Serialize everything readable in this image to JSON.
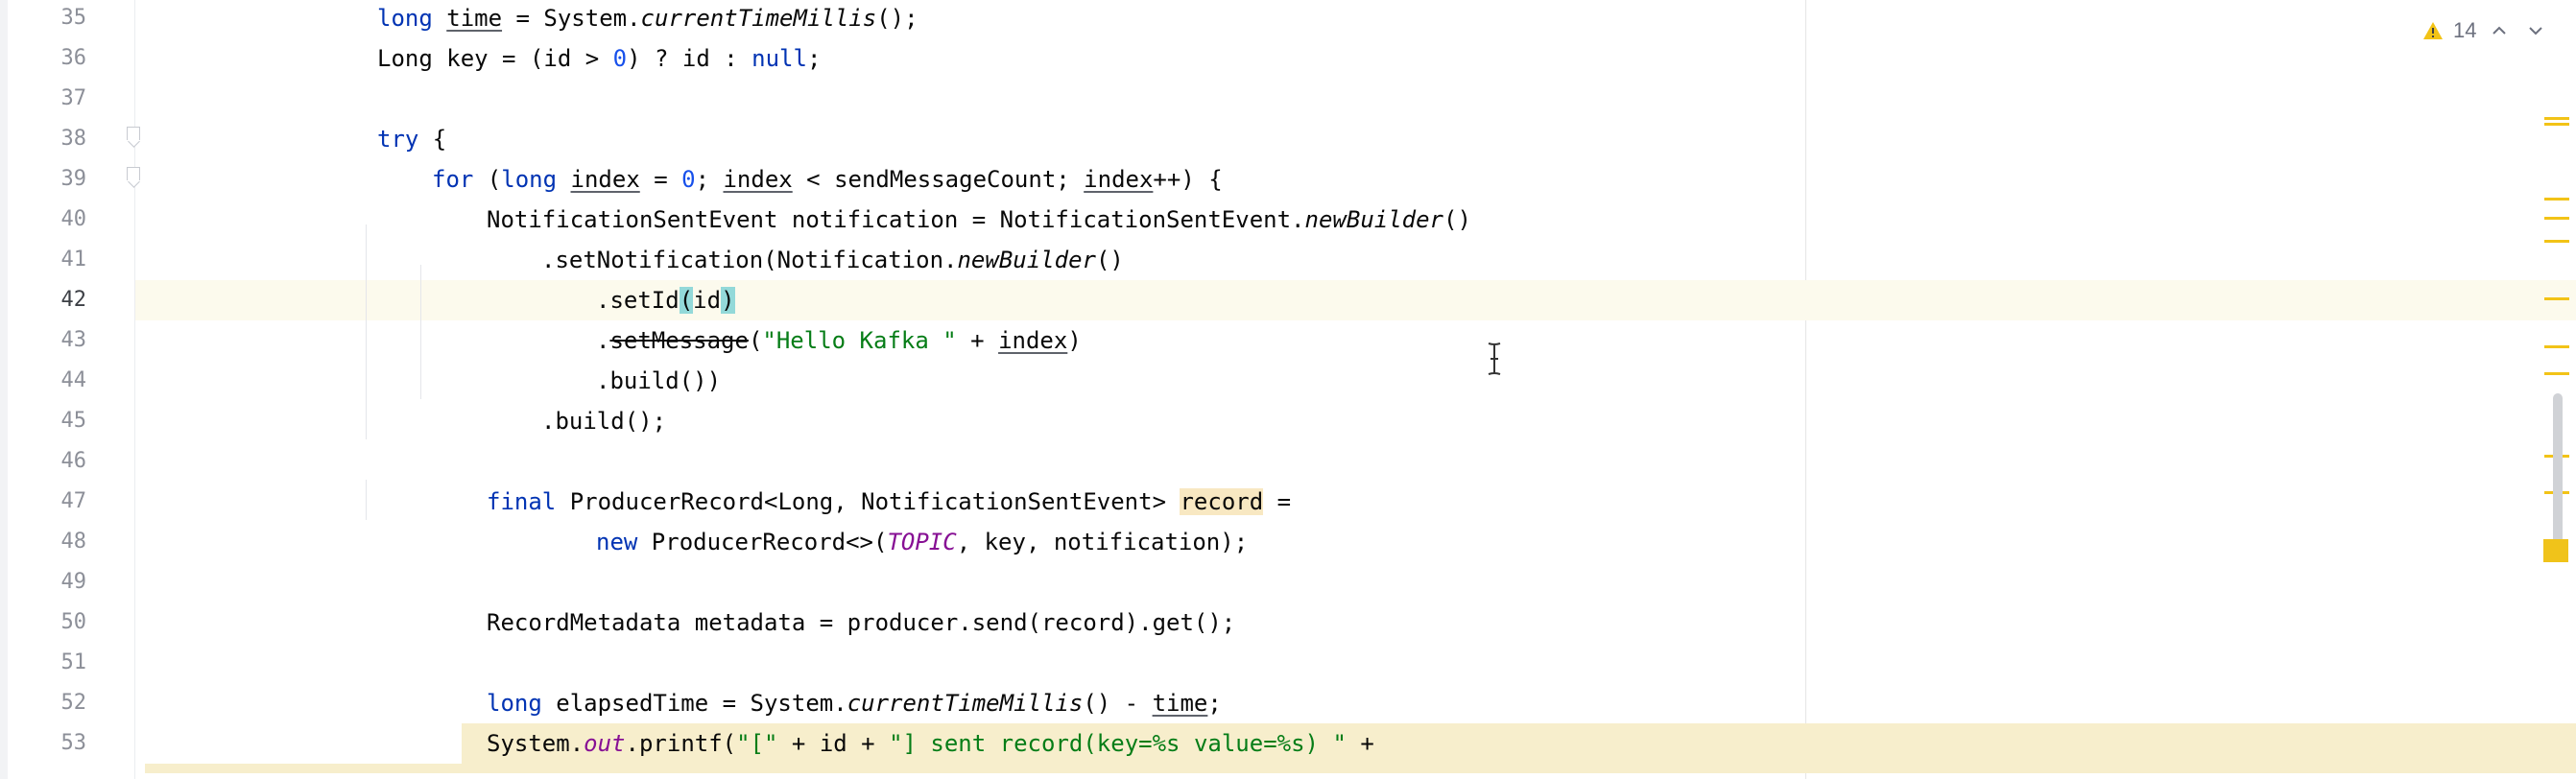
{
  "editor": {
    "lines": [
      {
        "n": "35",
        "html": "<span class=\"kw\">long</span> <span class=\"ul\">time</span> = System.<span class=\"it\">currentTimeMillis</span>();"
      },
      {
        "n": "36",
        "html": "Long key = (id &gt; <span class=\"num\">0</span>) ? id : <span class=\"kw\">null</span>;"
      },
      {
        "n": "37",
        "html": ""
      },
      {
        "n": "38",
        "html": "<span class=\"kw\">try</span> {"
      },
      {
        "n": "39",
        "html": "<span class=\"kw\">for</span> (<span class=\"kw\">long</span> <span class=\"ul\">index</span> = <span class=\"num\">0</span>; <span class=\"ul\">index</span> &lt; sendMessageCount; <span class=\"ul\">index</span>++) {"
      },
      {
        "n": "40",
        "html": "NotificationSentEvent notification = NotificationSentEvent.<span class=\"it\">newBuilder</span>()"
      },
      {
        "n": "41",
        "html": ".setNotification(Notification.<span class=\"it\">newBuilder</span>()"
      },
      {
        "n": "42",
        "html": ".setId<span class=\"paren-hl\">(</span>id<span class=\"paren-hl\">)</span>"
      },
      {
        "n": "43",
        "html": ".<span class=\"strike\">setMessage</span>(<span class=\"str\">\"Hello Kafka \"</span> + <span class=\"ul\">index</span>)"
      },
      {
        "n": "44",
        "html": ".build())"
      },
      {
        "n": "45",
        "html": ".build();"
      },
      {
        "n": "46",
        "html": ""
      },
      {
        "n": "47",
        "html": "<span class=\"kw\">final</span> ProducerRecord&lt;Long, NotificationSentEvent&gt; <span class=\"ident-hl\">record</span> ="
      },
      {
        "n": "48",
        "html": "<span class=\"kw\">new</span> ProducerRecord&lt;&gt;(<span class=\"const\">TOPIC</span>, key, notification);"
      },
      {
        "n": "49",
        "html": ""
      },
      {
        "n": "50",
        "html": "RecordMetadata metadata = producer.send(record).get();"
      },
      {
        "n": "51",
        "html": ""
      },
      {
        "n": "52",
        "html": "<span class=\"kw\">long</span> elapsedTime = System.<span class=\"it\">currentTimeMillis</span>() - <span class=\"ul\">time</span>;"
      },
      {
        "n": "53",
        "html": "System.<span class=\"const\">out</span>.printf(<span class=\"str\">\"[\"</span> + id + <span class=\"str\">\"] sent record(key=%s value=%s) \"</span> +"
      }
    ],
    "caret_line": "42"
  },
  "inspections": {
    "warning_count": "14",
    "warning_icon": "warning-triangle-icon",
    "prev_icon": "chevron-up-icon",
    "next_icon": "chevron-down-icon"
  },
  "colors": {
    "keyword": "#0033b3",
    "string": "#067d17",
    "number": "#1750eb",
    "constant": "#871094",
    "warning": "#f2c317"
  }
}
